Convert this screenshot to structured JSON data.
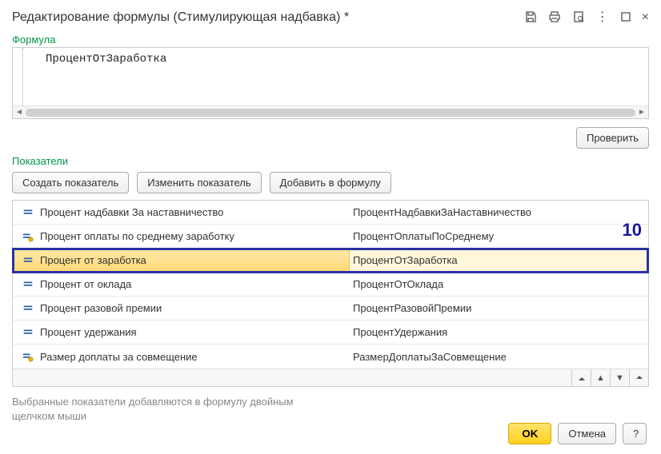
{
  "header": {
    "title": "Редактирование формулы (Стимулирующая надбавка) *"
  },
  "formula": {
    "label": "Формула",
    "content": "ПроцентОтЗаработка",
    "check_button": "Проверить"
  },
  "indicators": {
    "label": "Показатели",
    "toolbar": {
      "create": "Создать показатель",
      "edit": "Изменить показатель",
      "add": "Добавить в формулу"
    },
    "rows": [
      {
        "icon": "equals",
        "name": "Процент надбавки За наставничество",
        "code": "ПроцентНадбавкиЗаНаставничество"
      },
      {
        "icon": "equals-key",
        "name": "Процент оплаты по среднему заработку",
        "code": "ПроцентОплатыПоСреднему"
      },
      {
        "icon": "equals",
        "name": "Процент от заработка",
        "code": "ПроцентОтЗаработка",
        "selected": true
      },
      {
        "icon": "equals",
        "name": "Процент от оклада",
        "code": "ПроцентОтОклада"
      },
      {
        "icon": "equals",
        "name": "Процент разовой премии",
        "code": "ПроцентРазовойПремии"
      },
      {
        "icon": "equals",
        "name": "Процент удержания",
        "code": "ПроцентУдержания"
      },
      {
        "icon": "equals-key",
        "name": "Размер доплаты за совмещение",
        "code": "РазмерДоплатыЗаСовмещение"
      }
    ]
  },
  "annotation": "10",
  "hint": "Выбранные показатели добавляются в формулу двойным щелчком мыши",
  "footer": {
    "ok": "OK",
    "cancel": "Отмена",
    "help": "?"
  }
}
